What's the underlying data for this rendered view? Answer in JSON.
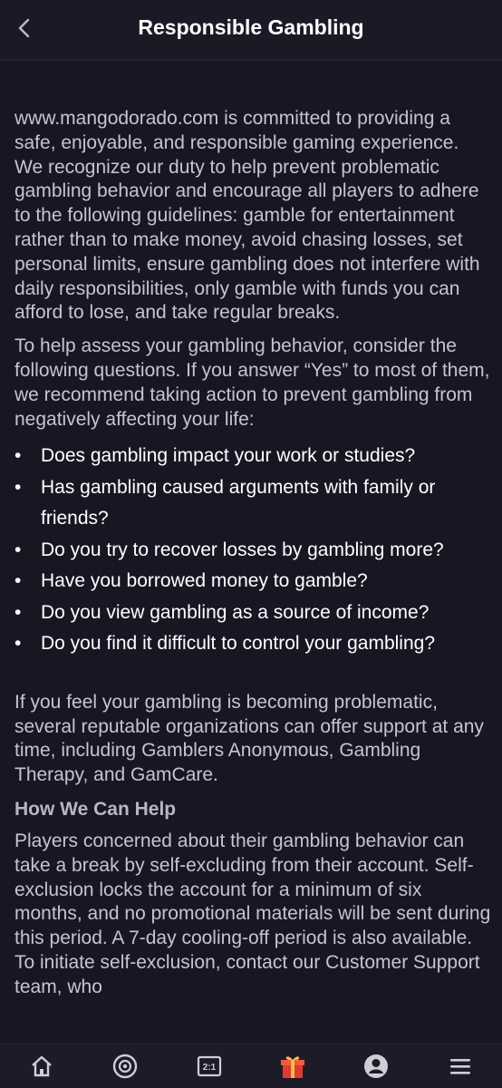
{
  "header": {
    "title": "Responsible Gambling"
  },
  "content": {
    "intro": "www.mangodorado.com is committed to providing a safe, enjoyable, and responsible gaming experience. We recognize our duty to help prevent problematic gambling behavior and encourage all players to adhere to the following guidelines: gamble for entertainment rather than to make money, avoid chasing losses, set personal limits, ensure gambling does not interfere with daily responsibilities, only gamble with funds you can afford to lose, and take regular breaks.",
    "assess": "To help assess your gambling behavior, consider the following questions. If you answer “Yes” to most of them, we recommend taking action to prevent gambling from negatively affecting your life:",
    "questions": [
      "Does gambling impact your work or studies?",
      "Has gambling caused arguments with family or friends?",
      "Do you try to recover losses by gambling more?",
      "Have you borrowed money to gamble?",
      "Do you view gambling as a source of income?",
      "Do you find it difficult to control your gambling?"
    ],
    "support": "If you feel your gambling is becoming problematic, several reputable organizations can offer support at any time, including Gamblers Anonymous, Gambling Therapy, and GamCare.",
    "help_heading": "How We Can Help",
    "help_text": "Players concerned about their gambling behavior can take a break by self-excluding from their account. Self-exclusion locks the account for a minimum of six months, and no promotional materials will be sent during this period. A 7-day cooling-off period is also available. To initiate self-exclusion, contact our Customer Support team, who"
  },
  "bottom_nav": {
    "items": [
      "home-icon",
      "casino-chip-icon",
      "scoreboard-icon",
      "gift-icon",
      "profile-icon",
      "menu-icon"
    ],
    "scoreboard_text": "2:1"
  },
  "colors": {
    "background": "#191624",
    "accent": "#f5a623",
    "gift_red": "#e03b2e"
  }
}
